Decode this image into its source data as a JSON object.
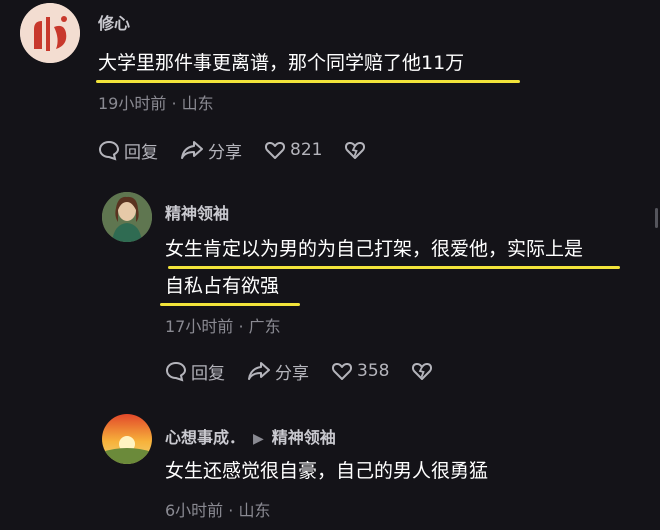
{
  "comments": [
    {
      "author": "修心",
      "text": "大学里那件事更离谱，那个同学赔了他11万",
      "meta": "19小时前 · 山东",
      "reply_label": "回复",
      "share_label": "分享",
      "likes": "821"
    },
    {
      "author": "精神领袖",
      "text_line1": "女生肯定以为男的为自己打架，很爱他，实际上是",
      "text_line2": "自私占有欲强",
      "meta": "17小时前 · 广东",
      "reply_label": "回复",
      "share_label": "分享",
      "likes": "358"
    },
    {
      "author": "心想事成．",
      "reply_to": "精神领袖",
      "text": "女生还感觉很自豪，自己的男人很勇猛",
      "meta": "6小时前 · 山东"
    }
  ],
  "colors": {
    "background": "#141318",
    "highlight": "#f2e43a",
    "muted": "#8a8a92"
  },
  "icons": [
    "reply-icon",
    "share-icon",
    "heart-icon",
    "dislike-icon",
    "caret-right-icon"
  ]
}
